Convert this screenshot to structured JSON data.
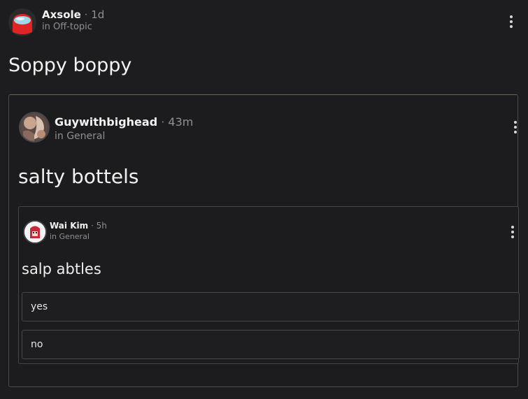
{
  "post": {
    "author": "Axsole",
    "separator": "·",
    "time": "1d",
    "channel": "in Off-topic",
    "title": "Soppy boppy",
    "menu_icon": "kebab-menu-icon",
    "avatar_icon": "red-crewmate-avatar"
  },
  "quoted": {
    "author": "Guywithbighead",
    "separator": "·",
    "time": "43m",
    "channel": "in General",
    "title": "salty bottels",
    "menu_icon": "kebab-menu-icon",
    "avatar_icon": "user-photo-avatar",
    "quoted": {
      "author": "Wai Kim",
      "separator": "·",
      "time": "5h",
      "channel": "in General",
      "title": "salp abtles",
      "menu_icon": "kebab-menu-icon",
      "avatar_icon": "user-photo-avatar",
      "poll_options": [
        "yes",
        "no"
      ]
    }
  },
  "colors": {
    "background": "#1d1d1f",
    "border": "#4a4a4c",
    "text": "#e8e8e8",
    "muted": "#8f8f8f"
  }
}
